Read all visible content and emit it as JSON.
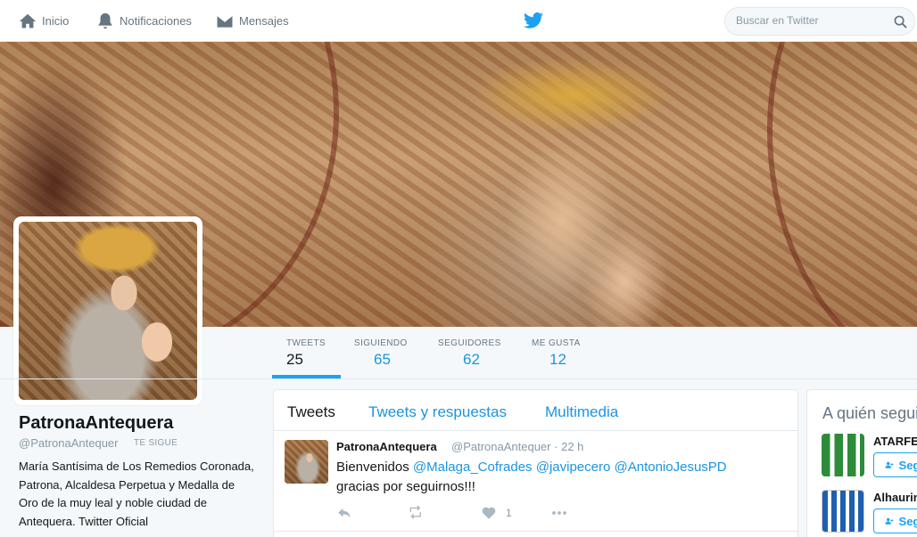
{
  "nav": {
    "home_label": "Inicio",
    "notifications_label": "Notificaciones",
    "messages_label": "Mensajes",
    "search_placeholder": "Buscar en Twitter"
  },
  "profile": {
    "name": "PatronaAntequera",
    "handle": "@PatronaAntequer",
    "follows_you": "TE SIGUE",
    "bio": "María Santísima de Los Remedios Coronada, Patrona, Alcaldesa Perpetua y Medalla de Oro de la muy leal y noble ciudad de Antequera. Twitter Oficial"
  },
  "stats": [
    {
      "label": "TWEETS",
      "value": "25",
      "active": true
    },
    {
      "label": "SIGUIENDO",
      "value": "65",
      "active": false
    },
    {
      "label": "SEGUIDORES",
      "value": "62",
      "active": false
    },
    {
      "label": "ME GUSTA",
      "value": "12",
      "active": false
    }
  ],
  "timeline": {
    "tabs": [
      "Tweets",
      "Tweets y respuestas",
      "Multimedia"
    ],
    "tweet": {
      "name": "PatronaAntequera",
      "handle": "@PatronaAntequer",
      "separator": "·",
      "time": "22 h",
      "text_prefix": "Bienvenidos ",
      "mentions": [
        "@Malaga_Cofrades",
        "@javipecero",
        "@AntonioJesusPD"
      ],
      "text_suffix": "gracias por seguirnos!!!",
      "like_count": "1"
    }
  },
  "who_to_follow": {
    "title": "A quién seguir",
    "follow_label": "Seguir",
    "accounts": [
      {
        "name": "ATARFE",
        "avatar_color": "#2e8b3a"
      },
      {
        "name": "Alhaurin",
        "avatar_color": "#1f5fb0"
      }
    ]
  },
  "colors": {
    "accent": "#1da1f2",
    "link": "#1b95e0",
    "muted": "#8899a6"
  }
}
